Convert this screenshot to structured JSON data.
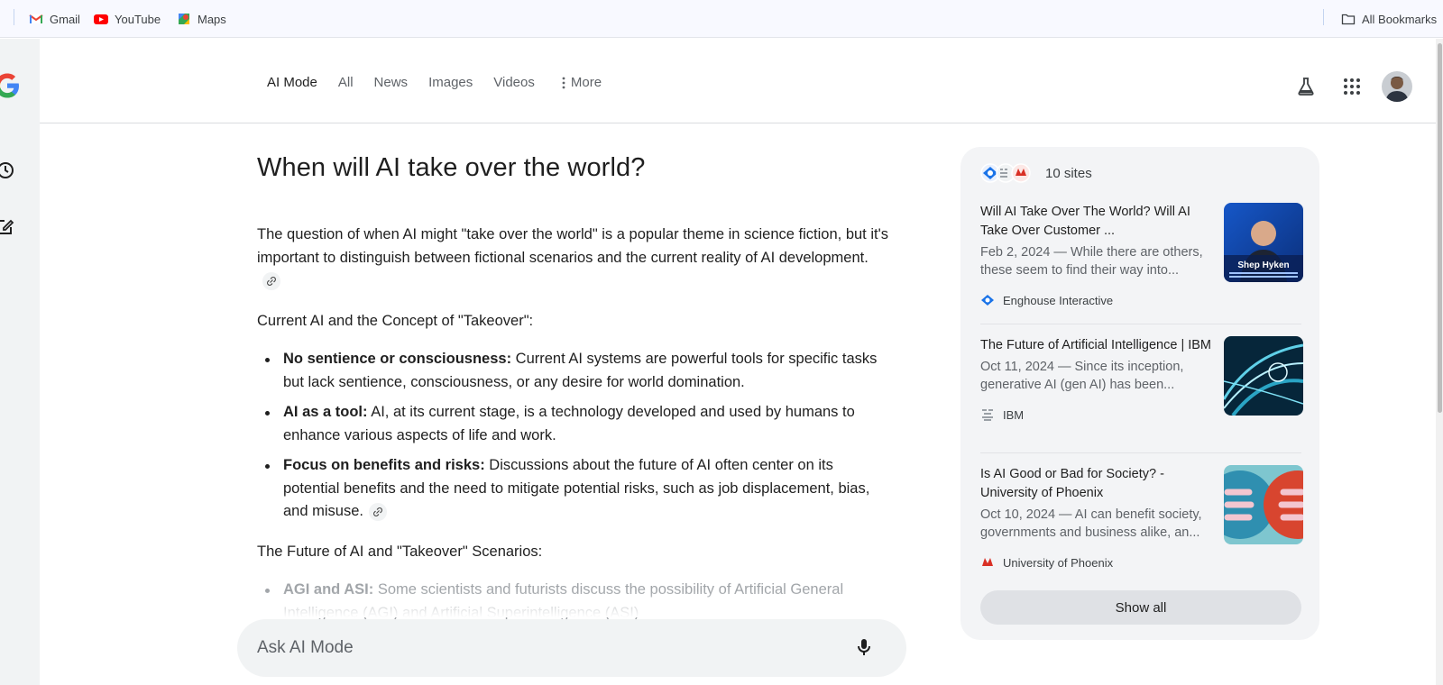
{
  "bookmarks": {
    "items": [
      {
        "label": "Gmail",
        "icon": "gmail-icon"
      },
      {
        "label": "YouTube",
        "icon": "youtube-icon"
      },
      {
        "label": "Maps",
        "icon": "maps-icon"
      }
    ],
    "all_bookmarks": "All Bookmarks"
  },
  "nav": {
    "tabs": [
      "AI Mode",
      "All",
      "News",
      "Images",
      "Videos"
    ],
    "more": "More"
  },
  "main": {
    "question": "When will AI take over the world?",
    "intro": "The question of when AI might \"take over the world\" is a popular theme in science fiction, but it's important to distinguish between fictional scenarios and the current reality of AI development.",
    "section1": "Current AI and the Concept of \"Takeover\":",
    "bullets1": [
      {
        "bold": "No sentience or consciousness:",
        "text": " Current AI systems are powerful tools for specific tasks but lack sentience, consciousness, or any desire for world domination."
      },
      {
        "bold": "AI as a tool:",
        "text": " AI, at its current stage, is a technology developed and used by humans to enhance various aspects of life and work."
      },
      {
        "bold": "Focus on benefits and risks:",
        "text": " Discussions about the future of AI often center on its potential benefits and the need to mitigate potential risks, such as job displacement, bias, and misuse."
      }
    ],
    "section2": "The Future of AI and \"Takeover\" Scenarios:",
    "bullets2": [
      {
        "bold": "AGI and ASI:",
        "text": " Some scientists and futurists discuss the possibility of Artificial General Intelligence (AGI) and Artificial Superintelligence (ASI)"
      }
    ]
  },
  "ask": {
    "placeholder": "Ask AI Mode"
  },
  "sources": {
    "count": "10 sites",
    "cards": [
      {
        "title": "Will AI Take Over The World? Will AI Take Over Customer ...",
        "snippet": "Feb 2, 2024 — While there are others, these seem to find their way into...",
        "site": "Enghouse Interactive",
        "thumb_caption": "Shep Hyken"
      },
      {
        "title": "The Future of Artificial Intelligence | IBM",
        "snippet": "Oct 11, 2024 — Since its inception, generative AI (gen AI) has been...",
        "site": "IBM"
      },
      {
        "title": "Is AI Good or Bad for Society? - University of Phoenix",
        "snippet": "Oct 10, 2024 — AI can benefit society, governments and business alike, an...",
        "site": "University of Phoenix"
      }
    ],
    "show_all": "Show all"
  },
  "colors": {
    "google_blue": "#4285f4",
    "google_red": "#ea4335",
    "google_yellow": "#fbbc05",
    "google_green": "#34a853"
  }
}
